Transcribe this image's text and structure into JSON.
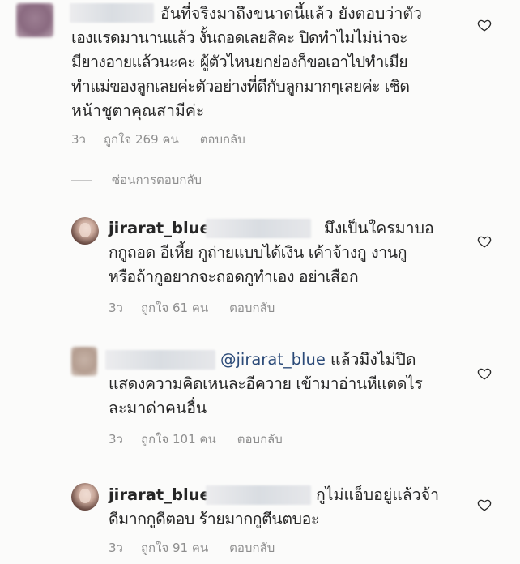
{
  "comments": [
    {
      "username": "",
      "lines": [
        "อันที่จริงมาถึงขนาดนี้แล้ว  ยังตอบว่าตัว",
        "เองแรดมานานแล้ว งั้นถอดเลยสิคะ ปิดทำไมไม่น่าจะ",
        "มียางอายแล้วนะคะ ผู้ตัวไหนยกย่องก็ขอเอาไปทำเมีย",
        "ทำแม่ของลูกเลยค่ะตัวอย่างที่ดีกับลูกมากๆเลยค่ะ เชิด",
        "หน้าชูตาคุณสามีค่ะ"
      ],
      "time": "3ว",
      "likes": "ถูกใจ 269 คน",
      "reply": "ตอบกลับ"
    },
    {
      "username": "jirarat_blue",
      "lines": [
        "มึงเป็นใครมาบอ",
        "กกูถอด อีเหี้ย กูถ่ายแบบได้เงิน เค้าจ้างกู งานกู",
        "หรือถ้ากูอยากจะถอดกูทำเอง อย่าเสือก"
      ],
      "time": "3ว",
      "likes": "ถูกใจ 61 คน",
      "reply": "ตอบกลับ"
    },
    {
      "username": "",
      "mention": "@jirarat_blue",
      "lines": [
        " แล้วมึงไม่ปิด",
        "แสดงความคิดเหนละอีควาย เข้ามาอ่านหีแตดไร",
        "ละมาด่าคนอื่น"
      ],
      "time": "3ว",
      "likes": "ถูกใจ 101 คน",
      "reply": "ตอบกลับ"
    },
    {
      "username": "jirarat_blue",
      "lines": [
        "กูไม่แอ็บอยู่แล้วจ้า",
        "ดีมากกูดีตอบ ร้ายมากกูตีนตบอะ"
      ],
      "time": "3ว",
      "likes": "ถูกใจ 91 คน",
      "reply": "ตอบกลับ"
    }
  ],
  "hide_replies": "ซ่อนการตอบกลับ",
  "icons": {
    "like": "heart-outline-icon"
  },
  "colors": {
    "text": "#262626",
    "meta": "#8e8e8e",
    "mention": "#2b4a78"
  }
}
